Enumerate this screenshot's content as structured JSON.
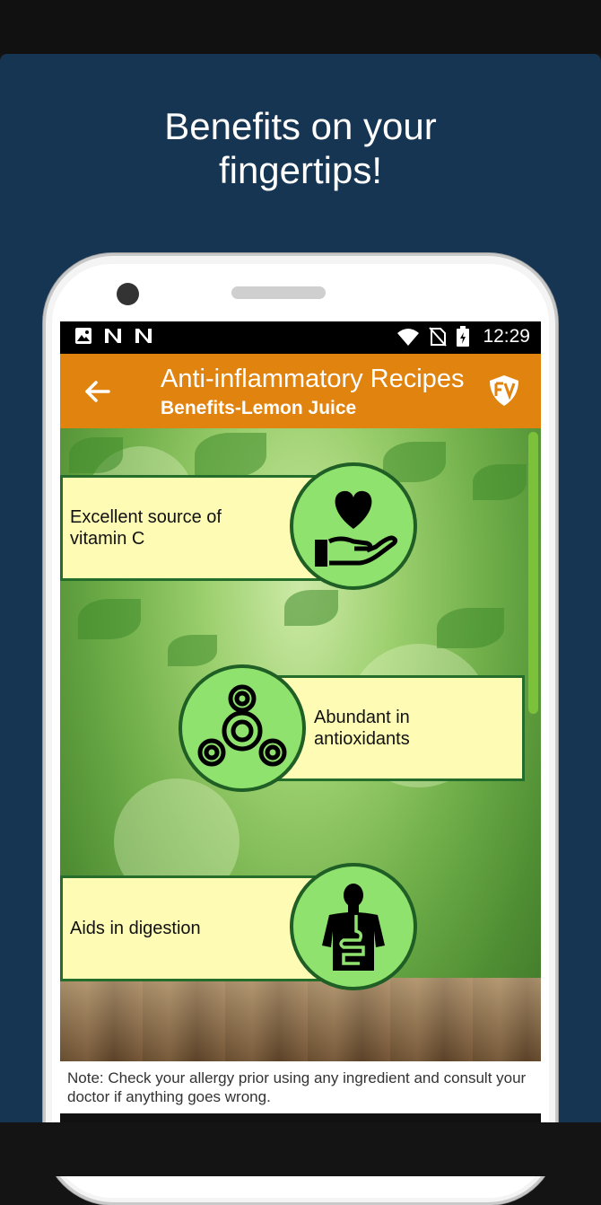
{
  "promo": {
    "headline_line1": "Benefits on your",
    "headline_line2": "fingertips!"
  },
  "status_bar": {
    "time": "12:29",
    "icons": [
      "image-icon",
      "n-icon",
      "n-icon",
      "wifi-icon",
      "no-sim-icon",
      "battery-icon"
    ]
  },
  "app_bar": {
    "title": "Anti-inflammatory Recipes",
    "subtitle": "Benefits-Lemon Juice",
    "back_icon": "arrow-left-icon",
    "logo_icon": "app-logo-icon"
  },
  "benefits": [
    {
      "text": "Excellent source of vitamin C",
      "icon": "heart-in-hand-icon"
    },
    {
      "text": "Abundant in antioxidants",
      "icon": "molecule-rings-icon"
    },
    {
      "text": "Aids in digestion",
      "icon": "digestive-system-icon"
    }
  ],
  "note": "Note: Check your allergy prior using any ingredient and consult your doctor if anything goes wrong.",
  "colors": {
    "promo_background": "#163553",
    "app_bar": "#e0830f",
    "card_fill": "#fefcb4",
    "card_border": "#256d2a",
    "badge_fill": "#8fe26e"
  }
}
